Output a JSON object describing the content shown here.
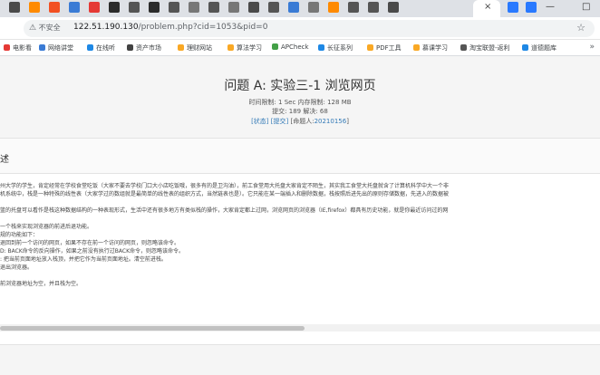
{
  "browser": {
    "active_tab_close": "×",
    "window_buttons": {
      "minimize": "—",
      "maximize": "□"
    },
    "nav": {
      "back": "←",
      "forward": "→",
      "reload": "↻"
    },
    "insecure_label": "不安全",
    "url_host": "122.51.190.130",
    "url_path": "/problem.php?cid=1053&pid=0",
    "star": "☆",
    "tab_colors": [
      "#4a4a4a",
      "#ff8a00",
      "#f25022",
      "#3a7bd5",
      "#e53935",
      "#2b2b2b",
      "#555555",
      "#2b2b2b",
      "#555555",
      "#777777",
      "#555555",
      "#777777",
      "#4a4a4a",
      "#555555",
      "#3a7bd5",
      "#777777",
      "#ff8a00",
      "#555555",
      "#555555",
      "#4a4a4a",
      "#2979ff",
      "#2979ff"
    ]
  },
  "bookmarks": {
    "items": [
      {
        "label": "电影看",
        "color": "#e53935"
      },
      {
        "label": "网络讲堂",
        "color": "#3a7bd5"
      },
      {
        "label": "在线听",
        "color": "#1e88e5"
      },
      {
        "label": "资产市场",
        "color": "#424242"
      },
      {
        "label": "理财网站",
        "color": "#f9a825"
      },
      {
        "label": "算法学习",
        "color": "#f9a825"
      },
      {
        "label": "APCheck",
        "color": "#43a047"
      },
      {
        "label": "长征系列",
        "color": "#1e88e5"
      },
      {
        "label": "PDF工具",
        "color": "#f9a825"
      },
      {
        "label": "慕课学习",
        "color": "#f9a825"
      },
      {
        "label": "淘宝联盟-返利",
        "color": "#555555"
      },
      {
        "label": "道德题库",
        "color": "#1e88e5"
      }
    ],
    "more": "»"
  },
  "problem": {
    "title": "问题 A: 实验三-1 浏览网页",
    "limits": "时间限制: 1 Sec  内存限制: 128 MB",
    "stats": "提交: 189  解决: 68",
    "status_link": "[状态]",
    "submit_link": "[提交]",
    "author_prefix": "[命题人:",
    "author": "20210156",
    "author_suffix": "]"
  },
  "section": {
    "title": "述"
  },
  "description_lines": [
    "州大学的学生，肯定经常在学校食堂吃饭（大家不要去学校门口大小店吃饭哦，很多有的是卫沟油），前工食堂用大托盘大家肯定不陌生，其实我工食堂大托盘就含了计算机科学中大一个非",
    "机系统中，栈是一种特殊的线性表（大家学过的数组就是最简单的线性表的组织方式，当然链表也是）。它只能在某一端插入和删除数据，栈按照后进先出的原则存储数据，先进入的数据被",
    "",
    "篮的托盘可以看作是栈这种数据结构的一种表现形式，生活中还有很多地方有类似栈的操作，大家肯定都上过网，浏览网页的浏览器（IE,firefox）都具有历史功能，就是你最近访问过的网",
    "",
    "一个栈来实现浏览器的前进后退功能。",
    "规的功能如下：",
    "退回到前一个访问的网页，如果不存在前一个访问的网页，则忽略该命令。",
    "D: BACK命令的反向操作，如果之前没有执行过BACK命令，则忽略该命令。",
    ": 把当前页面地址放入栈顶，并把它作为当前页面地址。清空前进栈。",
    "退出浏览器。",
    "",
    "前浏览器地址为空，并且栈为空。"
  ]
}
